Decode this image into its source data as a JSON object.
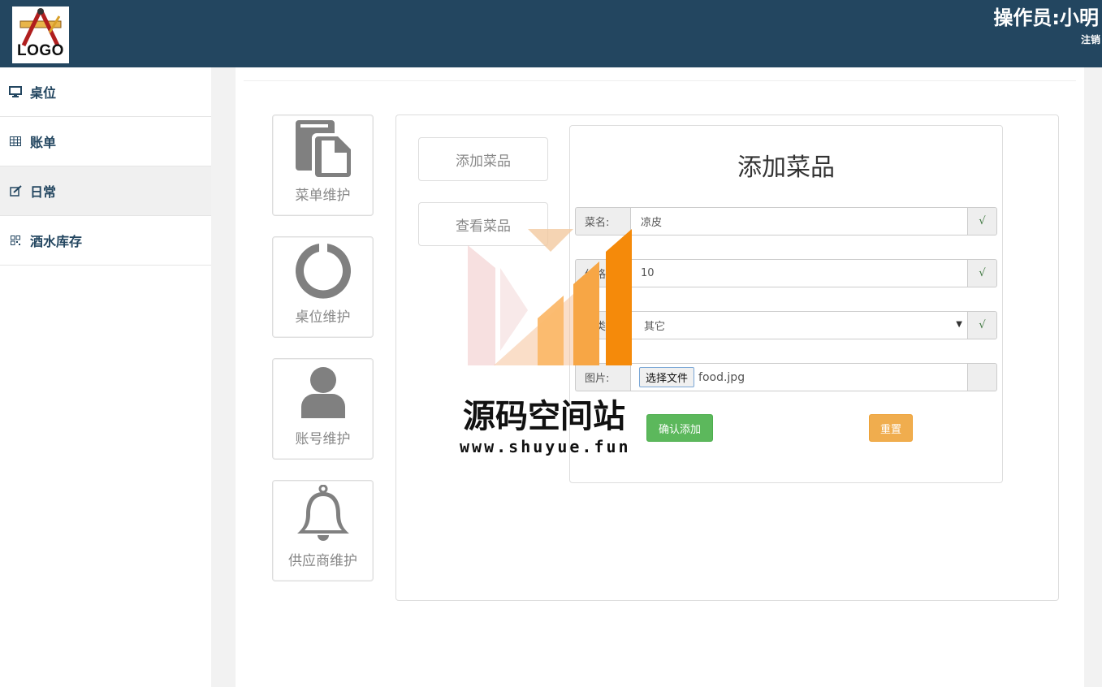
{
  "header": {
    "logo_text": "LOGO",
    "operator": "操作员:小明",
    "logout": "注销"
  },
  "sidebar": {
    "items": [
      {
        "label": "桌位",
        "icon": "monitor-icon"
      },
      {
        "label": "账单",
        "icon": "table-icon"
      },
      {
        "label": "日常",
        "icon": "edit-icon",
        "active": true
      },
      {
        "label": "酒水库存",
        "icon": "qrcode-icon"
      }
    ]
  },
  "tiles": [
    {
      "label": "菜单维护",
      "icon": "document-icon"
    },
    {
      "label": "桌位维护",
      "icon": "ring-icon"
    },
    {
      "label": "账号维护",
      "icon": "user-icon"
    },
    {
      "label": "供应商维护",
      "icon": "bell-icon"
    }
  ],
  "panel": {
    "add_dish_button": "添加菜品",
    "view_dish_button": "查看菜品"
  },
  "form": {
    "title": "添加菜品",
    "name_label": "菜名:",
    "name_value": "凉皮",
    "price_label": "价格:",
    "price_value": "10",
    "category_label": "分类:",
    "category_value": "其它",
    "image_label": "图片:",
    "file_button": "选择文件",
    "file_name": "food.jpg",
    "check_mark": "√",
    "confirm_button": "确认添加",
    "reset_button": "重置"
  },
  "watermark": {
    "title": "源码空间站",
    "url": "www.shuyue.fun"
  },
  "colors": {
    "header_bg": "#234660",
    "success": "#5cb85c",
    "warning": "#f0ad4e",
    "tile_icon": "#808080"
  }
}
